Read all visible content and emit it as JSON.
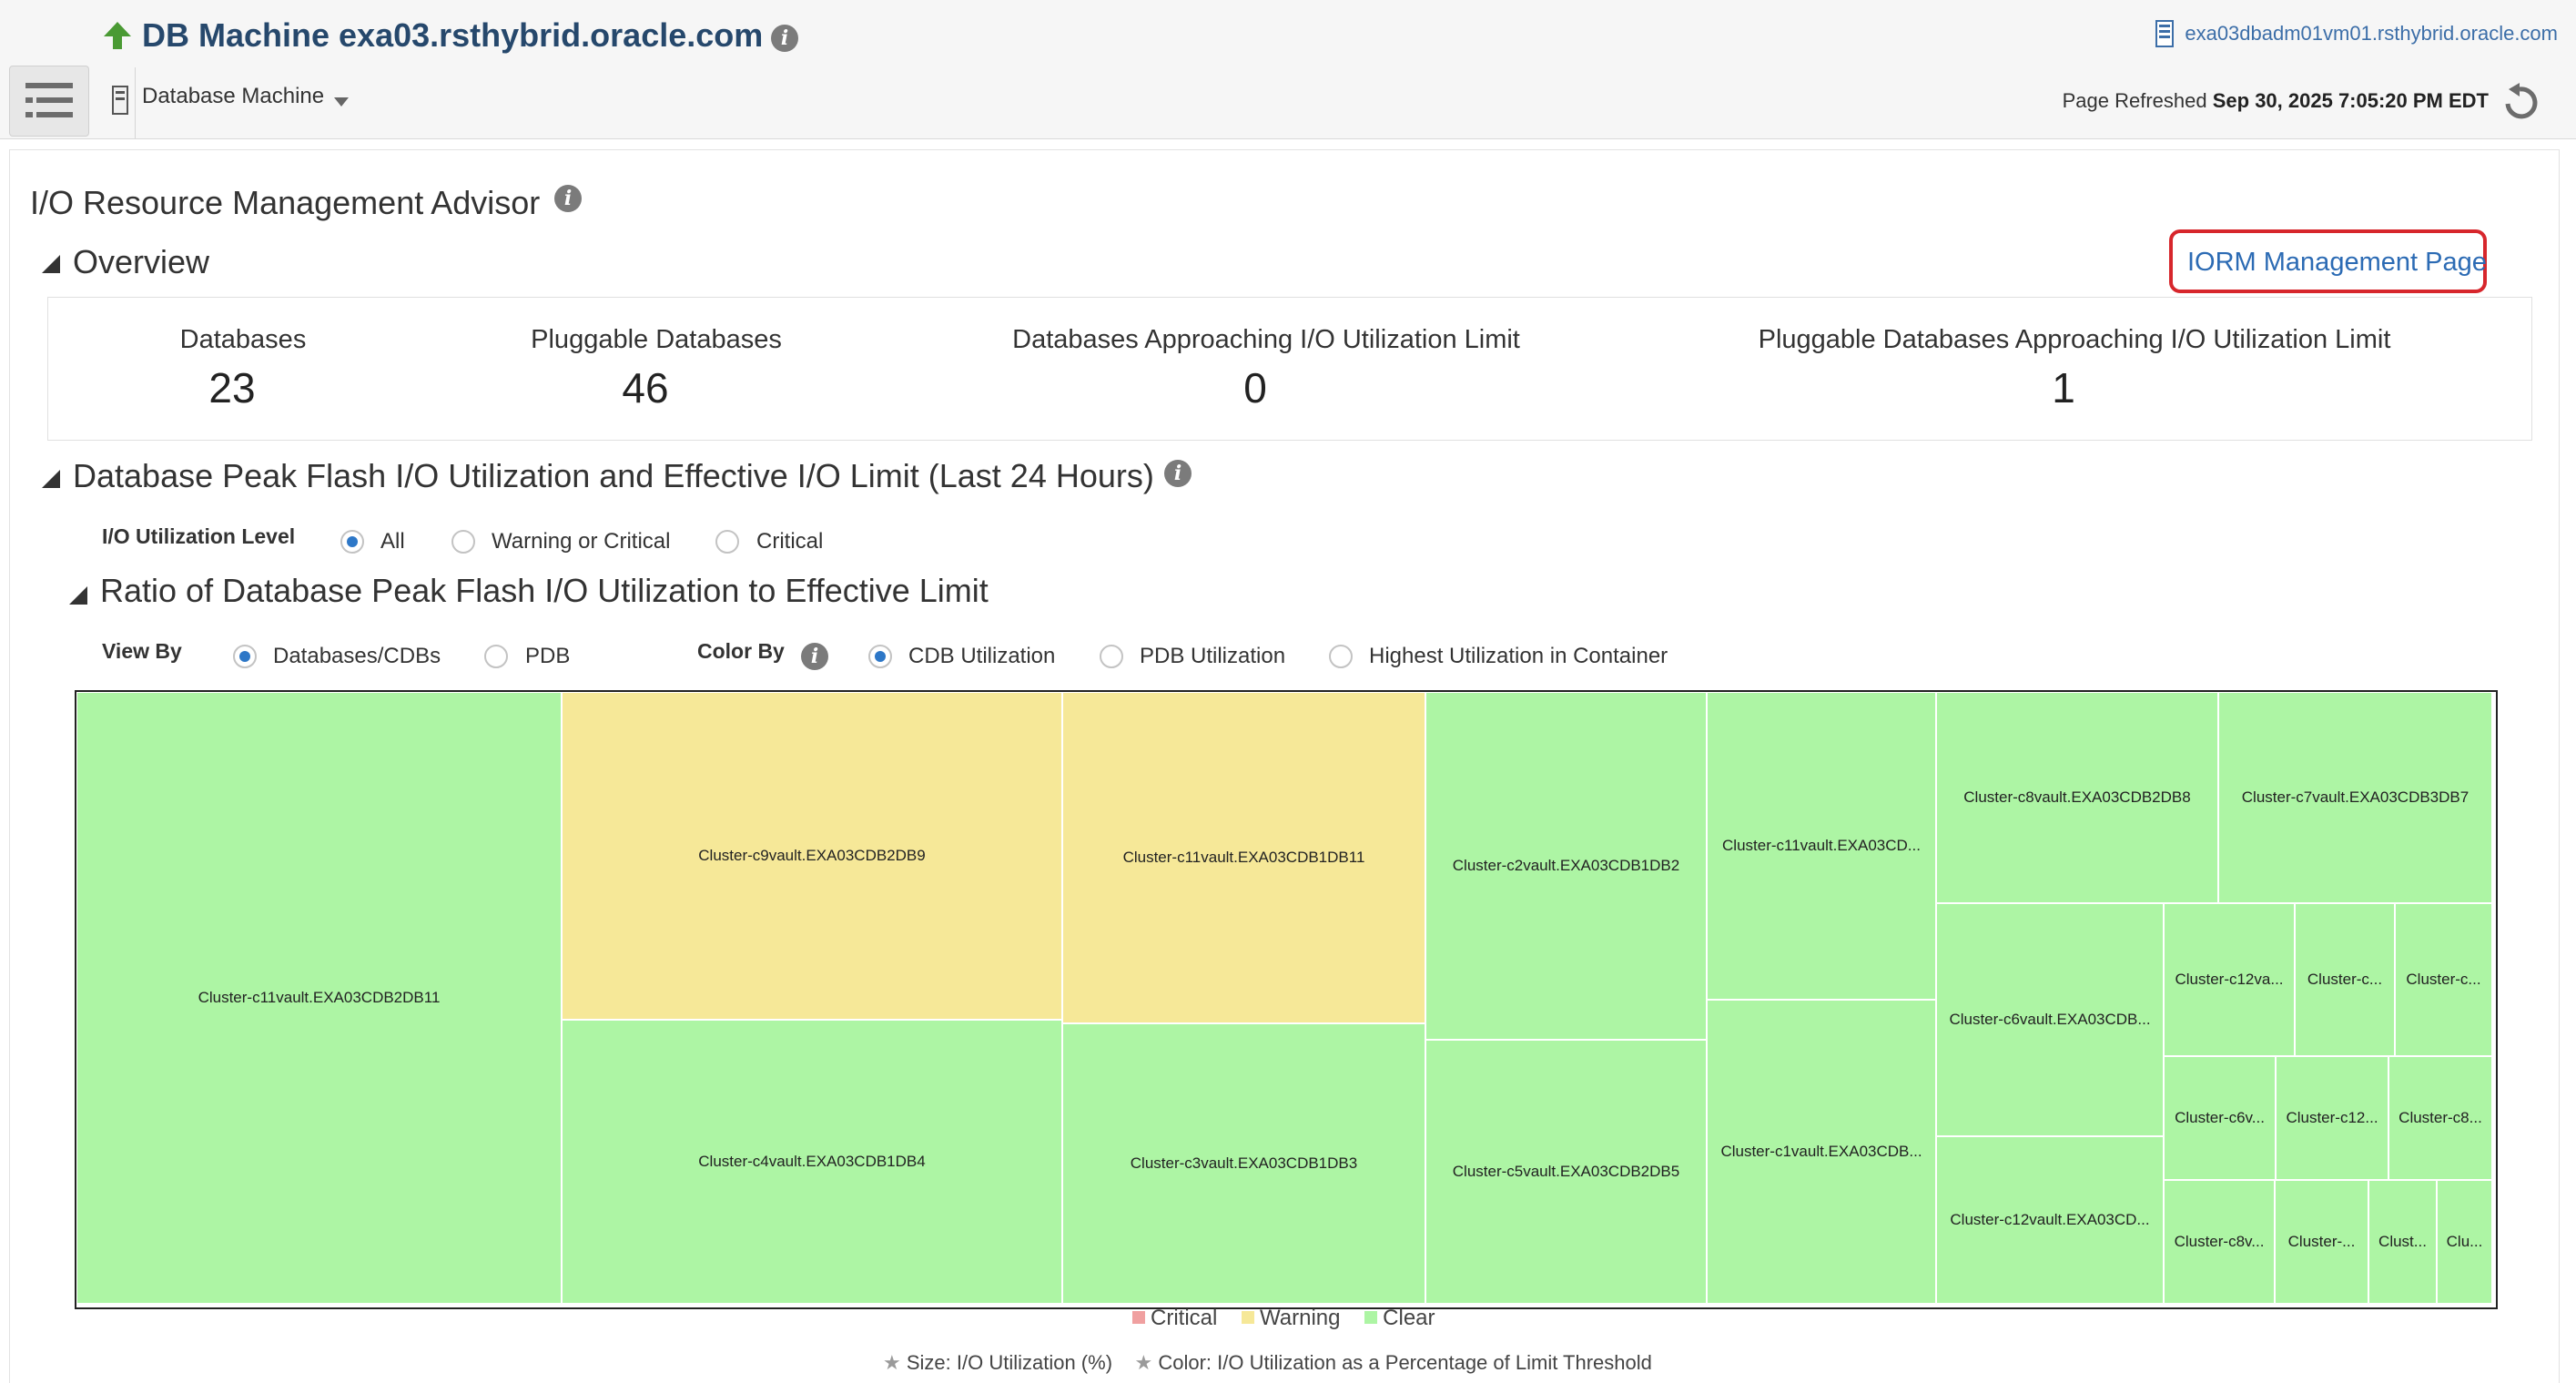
{
  "header": {
    "title": "DB Machine exa03.rsthybrid.oracle.com",
    "host": "exa03dbadm01vm01.rsthybrid.oracle.com",
    "target_menu": "Database Machine",
    "refresh_prefix": "Page Refreshed",
    "refresh_time": "Sep 30, 2025 7:05:20 PM EDT"
  },
  "page": {
    "heading": "I/O Resource Management Advisor",
    "iorm_link": "IORM Management Page"
  },
  "overview": {
    "heading": "Overview",
    "stats": [
      {
        "label": "Databases",
        "value": "23"
      },
      {
        "label": "Pluggable Databases",
        "value": "46"
      },
      {
        "label": "Databases Approaching I/O Utilization Limit",
        "value": "0"
      },
      {
        "label": "Pluggable Databases Approaching I/O Utilization Limit",
        "value": "1"
      }
    ]
  },
  "peak_section": {
    "heading": "Database Peak Flash I/O Utilization and Effective I/O Limit (Last 24 Hours)",
    "level_label": "I/O Utilization Level",
    "level_options": [
      "All",
      "Warning or Critical",
      "Critical"
    ],
    "level_selected": "All"
  },
  "ratio_section": {
    "heading": "Ratio of Database Peak Flash I/O Utilization to Effective Limit",
    "view_by_label": "View By",
    "view_by_options": [
      "Databases/CDBs",
      "PDB"
    ],
    "view_by_selected": "Databases/CDBs",
    "color_by_label": "Color By",
    "color_by_options": [
      "CDB Utilization",
      "PDB Utilization",
      "Highest Utilization in Container"
    ],
    "color_by_selected": "CDB Utilization"
  },
  "treemap": {
    "cells": [
      {
        "label": "Cluster-c11vault.EXA03CDB2DB11",
        "status": "clear"
      },
      {
        "label": "Cluster-c9vault.EXA03CDB2DB9",
        "status": "warning"
      },
      {
        "label": "Cluster-c4vault.EXA03CDB1DB4",
        "status": "clear"
      },
      {
        "label": "Cluster-c11vault.EXA03CDB1DB11",
        "status": "warning"
      },
      {
        "label": "Cluster-c3vault.EXA03CDB1DB3",
        "status": "clear"
      },
      {
        "label": "Cluster-c2vault.EXA03CDB1DB2",
        "status": "clear"
      },
      {
        "label": "Cluster-c5vault.EXA03CDB2DB5",
        "status": "clear"
      },
      {
        "label": "Cluster-c11vault.EXA03CD...",
        "status": "clear"
      },
      {
        "label": "Cluster-c1vault.EXA03CDB...",
        "status": "clear"
      },
      {
        "label": "Cluster-c8vault.EXA03CDB2DB8",
        "status": "clear"
      },
      {
        "label": "Cluster-c7vault.EXA03CDB3DB7",
        "status": "clear"
      },
      {
        "label": "Cluster-c6vault.EXA03CDB...",
        "status": "clear"
      },
      {
        "label": "Cluster-c12vault.EXA03CD...",
        "status": "clear"
      },
      {
        "label": "Cluster-c12va...",
        "status": "clear"
      },
      {
        "label": "Cluster-c...",
        "status": "clear"
      },
      {
        "label": "Cluster-c...",
        "status": "clear"
      },
      {
        "label": "Cluster-c6v...",
        "status": "clear"
      },
      {
        "label": "Cluster-c12...",
        "status": "clear"
      },
      {
        "label": "Cluster-c8...",
        "status": "clear"
      },
      {
        "label": "Cluster-c8v...",
        "status": "clear"
      },
      {
        "label": "Cluster-...",
        "status": "clear"
      },
      {
        "label": "Clust...",
        "status": "clear"
      },
      {
        "label": "Clu...",
        "status": "clear"
      }
    ],
    "legend": [
      {
        "label": "Critical",
        "color": "#f0a0a0"
      },
      {
        "label": "Warning",
        "color": "#f6e898"
      },
      {
        "label": "Clear",
        "color": "#adf5a4"
      }
    ],
    "footnote_size": "Size: I/O Utilization (%)",
    "footnote_color": "Color: I/O Utilization as a Percentage of Limit Threshold"
  }
}
